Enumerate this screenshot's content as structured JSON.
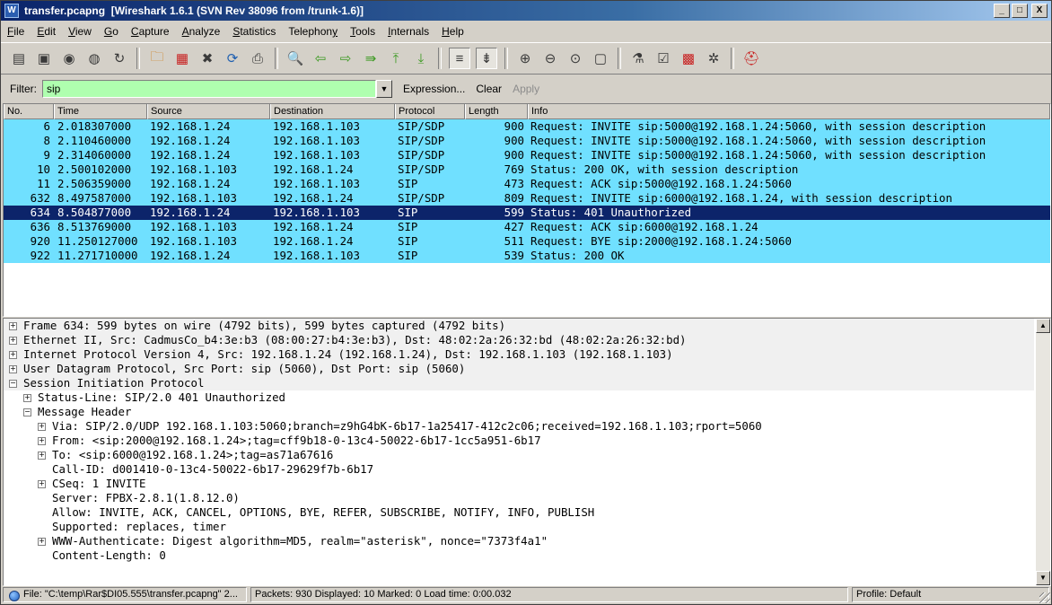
{
  "window": {
    "file": "transfer.pcapng",
    "title_rest": "[Wireshark 1.6.1  (SVN Rev 38096 from /trunk-1.6)]",
    "app_icon_glyph": "W",
    "minimize_glyph": "_",
    "maximize_glyph": "□",
    "close_glyph": "X"
  },
  "menu": [
    {
      "accel": "F",
      "rest": "ile"
    },
    {
      "accel": "E",
      "rest": "dit"
    },
    {
      "accel": "V",
      "rest": "iew"
    },
    {
      "accel": "G",
      "rest": "o"
    },
    {
      "accel": "C",
      "rest": "apture"
    },
    {
      "accel": "A",
      "rest": "nalyze"
    },
    {
      "accel": "S",
      "rest": "tatistics"
    },
    {
      "accel": "",
      "rest": "Telephon",
      "accel2": "y"
    },
    {
      "accel": "T",
      "rest": "ools"
    },
    {
      "accel": "I",
      "rest": "nternals"
    },
    {
      "accel": "H",
      "rest": "elp"
    }
  ],
  "toolbar": {
    "glyphs": {
      "interfaces": "▤",
      "options": "▣",
      "start": "◉",
      "stop": "◍",
      "restart": "↻",
      "open": "🗀",
      "save": "▦",
      "close": "✖",
      "reload": "⟳",
      "print": "⎙",
      "find": "🔍",
      "back": "⇦",
      "forward": "⇨",
      "goto": "⇛",
      "first": "⤒",
      "last": "⤓",
      "colorize": "≡",
      "autoscroll": "⇟",
      "zoom_in": "⊕",
      "zoom_out": "⊖",
      "zoom_normal": "⊙",
      "resize": "▢",
      "capture_filters": "⚗",
      "display_filters": "☑",
      "coloring": "▩",
      "prefs": "✲",
      "help": "⛑"
    }
  },
  "filter": {
    "label": "Filter:",
    "value": "sip",
    "dropdown_glyph": "▼",
    "expression": "Expression...",
    "clear": "Clear",
    "apply": "Apply",
    "color_valid": "#afffaf"
  },
  "packet_list": {
    "columns": [
      "No.",
      "Time",
      "Source",
      "Destination",
      "Protocol",
      "Length",
      "Info"
    ],
    "row_color": "#70e0ff",
    "selected_color": "#0c246a",
    "selected_index": 6,
    "rows": [
      {
        "no": "6",
        "time": "2.018307000",
        "src": "192.168.1.24",
        "dst": "192.168.1.103",
        "proto": "SIP/SDP",
        "len": "900",
        "info": "Request: INVITE sip:5000@192.168.1.24:5060, with session description"
      },
      {
        "no": "8",
        "time": "2.110460000",
        "src": "192.168.1.24",
        "dst": "192.168.1.103",
        "proto": "SIP/SDP",
        "len": "900",
        "info": "Request: INVITE sip:5000@192.168.1.24:5060, with session description"
      },
      {
        "no": "9",
        "time": "2.314060000",
        "src": "192.168.1.24",
        "dst": "192.168.1.103",
        "proto": "SIP/SDP",
        "len": "900",
        "info": "Request: INVITE sip:5000@192.168.1.24:5060, with session description"
      },
      {
        "no": "10",
        "time": "2.500102000",
        "src": "192.168.1.103",
        "dst": "192.168.1.24",
        "proto": "SIP/SDP",
        "len": "769",
        "info": "Status: 200 OK, with session description"
      },
      {
        "no": "11",
        "time": "2.506359000",
        "src": "192.168.1.24",
        "dst": "192.168.1.103",
        "proto": "SIP",
        "len": "473",
        "info": "Request: ACK sip:5000@192.168.1.24:5060"
      },
      {
        "no": "632",
        "time": "8.497587000",
        "src": "192.168.1.103",
        "dst": "192.168.1.24",
        "proto": "SIP/SDP",
        "len": "809",
        "info": "Request: INVITE sip:6000@192.168.1.24, with session description"
      },
      {
        "no": "634",
        "time": "8.504877000",
        "src": "192.168.1.24",
        "dst": "192.168.1.103",
        "proto": "SIP",
        "len": "599",
        "info": "Status: 401 Unauthorized"
      },
      {
        "no": "636",
        "time": "8.513769000",
        "src": "192.168.1.103",
        "dst": "192.168.1.24",
        "proto": "SIP",
        "len": "427",
        "info": "Request: ACK sip:6000@192.168.1.24"
      },
      {
        "no": "920",
        "time": "11.250127000",
        "src": "192.168.1.103",
        "dst": "192.168.1.24",
        "proto": "SIP",
        "len": "511",
        "info": "Request: BYE sip:2000@192.168.1.24:5060"
      },
      {
        "no": "922",
        "time": "11.271710000",
        "src": "192.168.1.24",
        "dst": "192.168.1.103",
        "proto": "SIP",
        "len": "539",
        "info": "Status: 200 OK"
      }
    ]
  },
  "detail_tree": [
    {
      "level": 0,
      "toggle": "+",
      "text": "Frame 634: 599 bytes on wire (4792 bits), 599 bytes captured (4792 bits)"
    },
    {
      "level": 0,
      "toggle": "+",
      "text": "Ethernet II, Src: CadmusCo_b4:3e:b3 (08:00:27:b4:3e:b3), Dst: 48:02:2a:26:32:bd (48:02:2a:26:32:bd)"
    },
    {
      "level": 0,
      "toggle": "+",
      "text": "Internet Protocol Version 4, Src: 192.168.1.24 (192.168.1.24), Dst: 192.168.1.103 (192.168.1.103)"
    },
    {
      "level": 0,
      "toggle": "+",
      "text": "User Datagram Protocol, Src Port: sip (5060), Dst Port: sip (5060)"
    },
    {
      "level": 0,
      "toggle": "−",
      "text": "Session Initiation Protocol"
    },
    {
      "level": 1,
      "toggle": "+",
      "text": "Status-Line: SIP/2.0 401 Unauthorized"
    },
    {
      "level": 1,
      "toggle": "−",
      "text": "Message Header"
    },
    {
      "level": 2,
      "toggle": "+",
      "text": "Via: SIP/2.0/UDP 192.168.1.103:5060;branch=z9hG4bK-6b17-1a25417-412c2c06;received=192.168.1.103;rport=5060"
    },
    {
      "level": 2,
      "toggle": "+",
      "text": "From: <sip:2000@192.168.1.24>;tag=cff9b18-0-13c4-50022-6b17-1cc5a951-6b17"
    },
    {
      "level": 2,
      "toggle": "+",
      "text": "To: <sip:6000@192.168.1.24>;tag=as71a67616"
    },
    {
      "level": 2,
      "toggle": "",
      "text": "Call-ID: d001410-0-13c4-50022-6b17-29629f7b-6b17"
    },
    {
      "level": 2,
      "toggle": "+",
      "text": "CSeq: 1 INVITE"
    },
    {
      "level": 2,
      "toggle": "",
      "text": "Server: FPBX-2.8.1(1.8.12.0)"
    },
    {
      "level": 2,
      "toggle": "",
      "text": "Allow: INVITE, ACK, CANCEL, OPTIONS, BYE, REFER, SUBSCRIBE, NOTIFY, INFO, PUBLISH"
    },
    {
      "level": 2,
      "toggle": "",
      "text": "Supported: replaces, timer"
    },
    {
      "level": 2,
      "toggle": "+",
      "text": "WWW-Authenticate: Digest algorithm=MD5, realm=\"asterisk\", nonce=\"7373f4a1\""
    },
    {
      "level": 2,
      "toggle": "",
      "text": "Content-Length: 0"
    }
  ],
  "status": {
    "file": "File: \"C:\\temp\\Rar$DI05.555\\transfer.pcapng\" 2...",
    "packets": "Packets: 930 Displayed: 10 Marked: 0 Load time: 0:00.032",
    "profile": "Profile: Default"
  },
  "scroll": {
    "left_glyph": "◀",
    "right_glyph": "▶",
    "up_glyph": "▲",
    "down_glyph": "▼"
  }
}
